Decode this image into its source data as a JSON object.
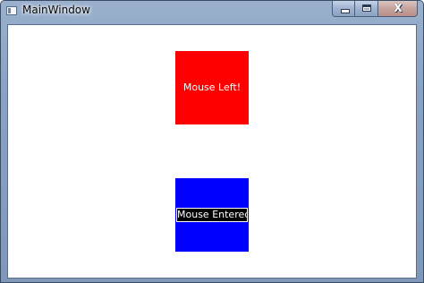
{
  "window": {
    "title": "MainWindow",
    "icon": "window-app-icon",
    "close_symbol": "X"
  },
  "colors": {
    "red_square": "#ff0000",
    "blue_square": "#0000ff",
    "label_text": "#ffffff"
  },
  "squares": [
    {
      "color": "red",
      "label": "Mouse Left!"
    },
    {
      "color": "blue",
      "label": "Mouse Entered!"
    }
  ]
}
